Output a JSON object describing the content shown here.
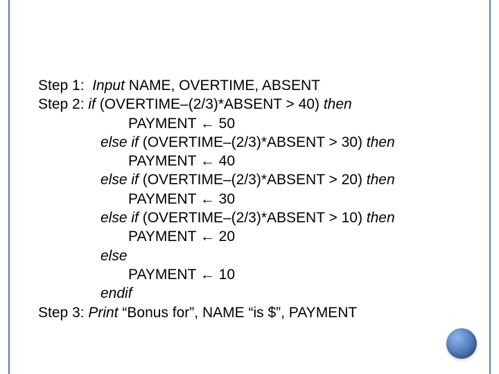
{
  "lines": {
    "l1_step": "Step 1:  ",
    "l1_kw": "Input",
    "l1_rest": " NAME, OVERTIME, ABSENT",
    "l2_step": "Step 2: ",
    "l2_kw": "if ",
    "l2_cond": "(OVERTIME–(2/3)*ABSENT > 40) ",
    "l2_then": "then",
    "l3": "PAYMENT ← 50",
    "l4_kw": "else if ",
    "l4_cond": "(OVERTIME–(2/3)*ABSENT > 30) ",
    "l4_then": "then",
    "l5": "PAYMENT ← 40",
    "l6_kw": "else if ",
    "l6_cond": "(OVERTIME–(2/3)*ABSENT > 20) ",
    "l6_then": "then",
    "l7": "PAYMENT ← 30",
    "l8_kw": "else if ",
    "l8_cond": "(OVERTIME–(2/3)*ABSENT > 10) ",
    "l8_then": "then",
    "l9": "PAYMENT ← 20",
    "l10_kw": "else",
    "l11": "PAYMENT ← 10",
    "l12_kw": "endif",
    "l13_step": "Step 3: ",
    "l13_kw": "Print ",
    "l13_rest": "“Bonus for”, NAME “is $”, PAYMENT"
  }
}
